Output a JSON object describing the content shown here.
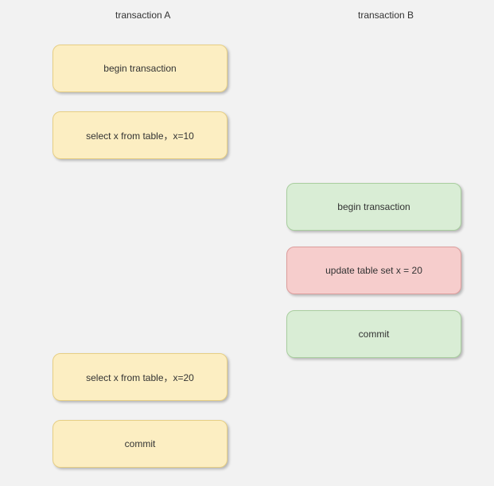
{
  "headers": {
    "a": "transaction A",
    "b": "transaction B"
  },
  "transA": {
    "begin": "begin transaction",
    "select1": "select x from table，x=10",
    "select2": "select x from table，x=20",
    "commit": "commit"
  },
  "transB": {
    "begin": "begin transaction",
    "update": "update table set x = 20",
    "commit": "commit"
  }
}
